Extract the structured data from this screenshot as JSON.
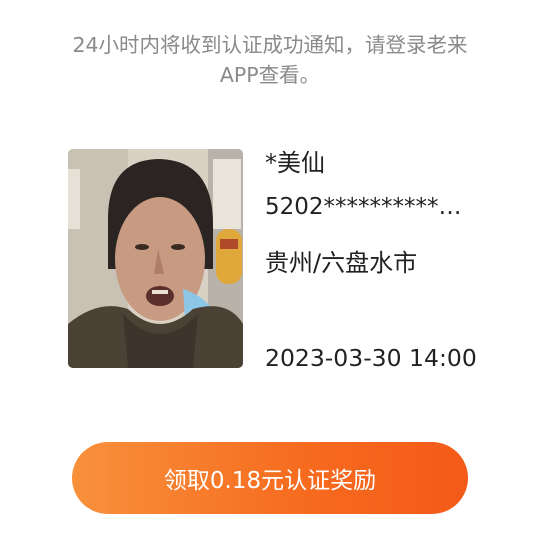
{
  "notice": {
    "line1": "24小时内将收到认证成功通知，请登录老来",
    "line2": "APP查看。"
  },
  "person": {
    "name": "*美仙",
    "id_number": "5202***********...",
    "region": "贵州/六盘水市",
    "datetime": "2023-03-30 14:00"
  },
  "action": {
    "reward_button_label": "领取0.18元认证奖励"
  },
  "colors": {
    "button_gradient_start": "#f8913c",
    "button_gradient_end": "#f45a18",
    "notice_text": "#8a8a8a",
    "primary_text": "#222222"
  }
}
